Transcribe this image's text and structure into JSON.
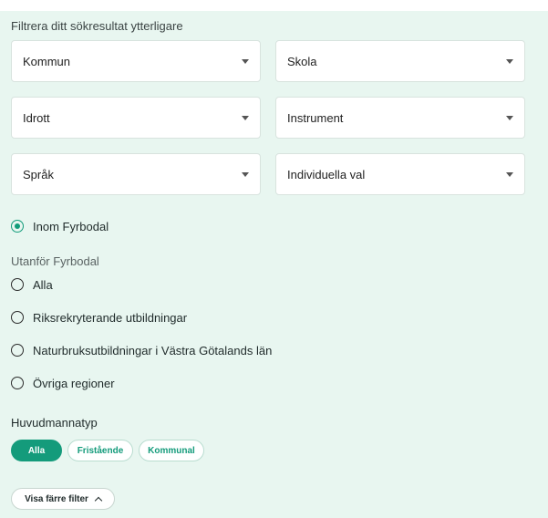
{
  "filter": {
    "heading": "Filtrera ditt sökresultat ytterligare",
    "selects": [
      {
        "label": "Kommun"
      },
      {
        "label": "Skola"
      },
      {
        "label": "Idrott"
      },
      {
        "label": "Instrument"
      },
      {
        "label": "Språk"
      },
      {
        "label": "Individuella val"
      }
    ]
  },
  "region": {
    "inside": {
      "label": "Inom Fyrbodal",
      "checked": true
    },
    "outside_label": "Utanför Fyrbodal",
    "outside_options": [
      {
        "label": "Alla",
        "checked": false
      },
      {
        "label": "Riksrekryterande utbildningar",
        "checked": false
      },
      {
        "label": "Naturbruksutbildningar i Västra Götalands län",
        "checked": false
      },
      {
        "label": "Övriga regioner",
        "checked": false
      }
    ]
  },
  "principal": {
    "label": "Huvudmannatyp",
    "options": [
      {
        "label": "Alla",
        "active": true
      },
      {
        "label": "Fristående",
        "active": false
      },
      {
        "label": "Kommunal",
        "active": false
      }
    ]
  },
  "toggle": {
    "label": "Visa färre filter"
  },
  "colors": {
    "accent": "#149b7b",
    "panel_bg": "#e8f6f0"
  },
  "icons": {
    "select_caret": "caret-down-icon",
    "toggle_chevron": "chevron-up-icon"
  }
}
